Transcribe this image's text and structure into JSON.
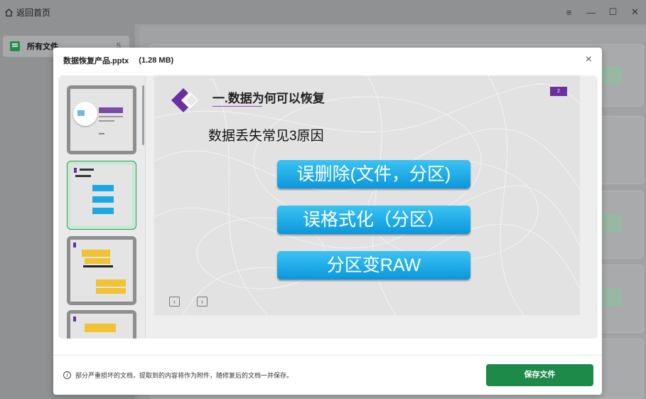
{
  "app": {
    "back_label": "返回首页",
    "window_controls": [
      "≡",
      "—",
      "☐",
      "✕"
    ]
  },
  "sidebar": {
    "items": [
      {
        "label": "所有文件",
        "count": "5"
      }
    ]
  },
  "modal": {
    "filename": "数据恢复产品.pptx",
    "filesize": "(1.28 MB)",
    "close_glyph": "×",
    "notice": "部分严重损坏的文档，提取到的内容将作为附件，随修复后的文档一并保存。",
    "save_label": "保存文件"
  },
  "slide": {
    "title": "一.数据为何可以恢复",
    "page_number": "2",
    "subtitle": "数据丢失常见3原因",
    "buttons": [
      "误删除(文件，分区)",
      "误格式化（分区）",
      "分区变RAW"
    ],
    "prev_glyph": "‹",
    "next_glyph": "›"
  },
  "colors": {
    "accent_green": "#1e8a49",
    "slide_button_cyan": "#0a97dc",
    "purple": "#6a2fa0"
  }
}
